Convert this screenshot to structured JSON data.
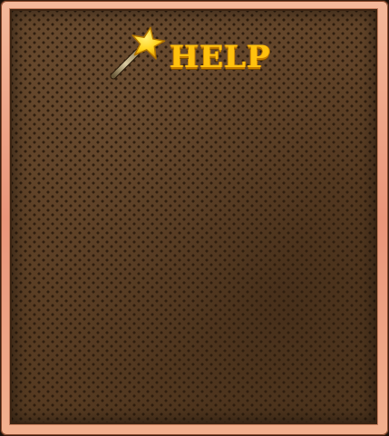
{
  "dialog": {
    "title": "HELP",
    "title_icon": "magic-wand-star-icon"
  },
  "colors": {
    "title": "#ffc20e",
    "frame": "#f2ac8c",
    "board": "#5e4127"
  }
}
